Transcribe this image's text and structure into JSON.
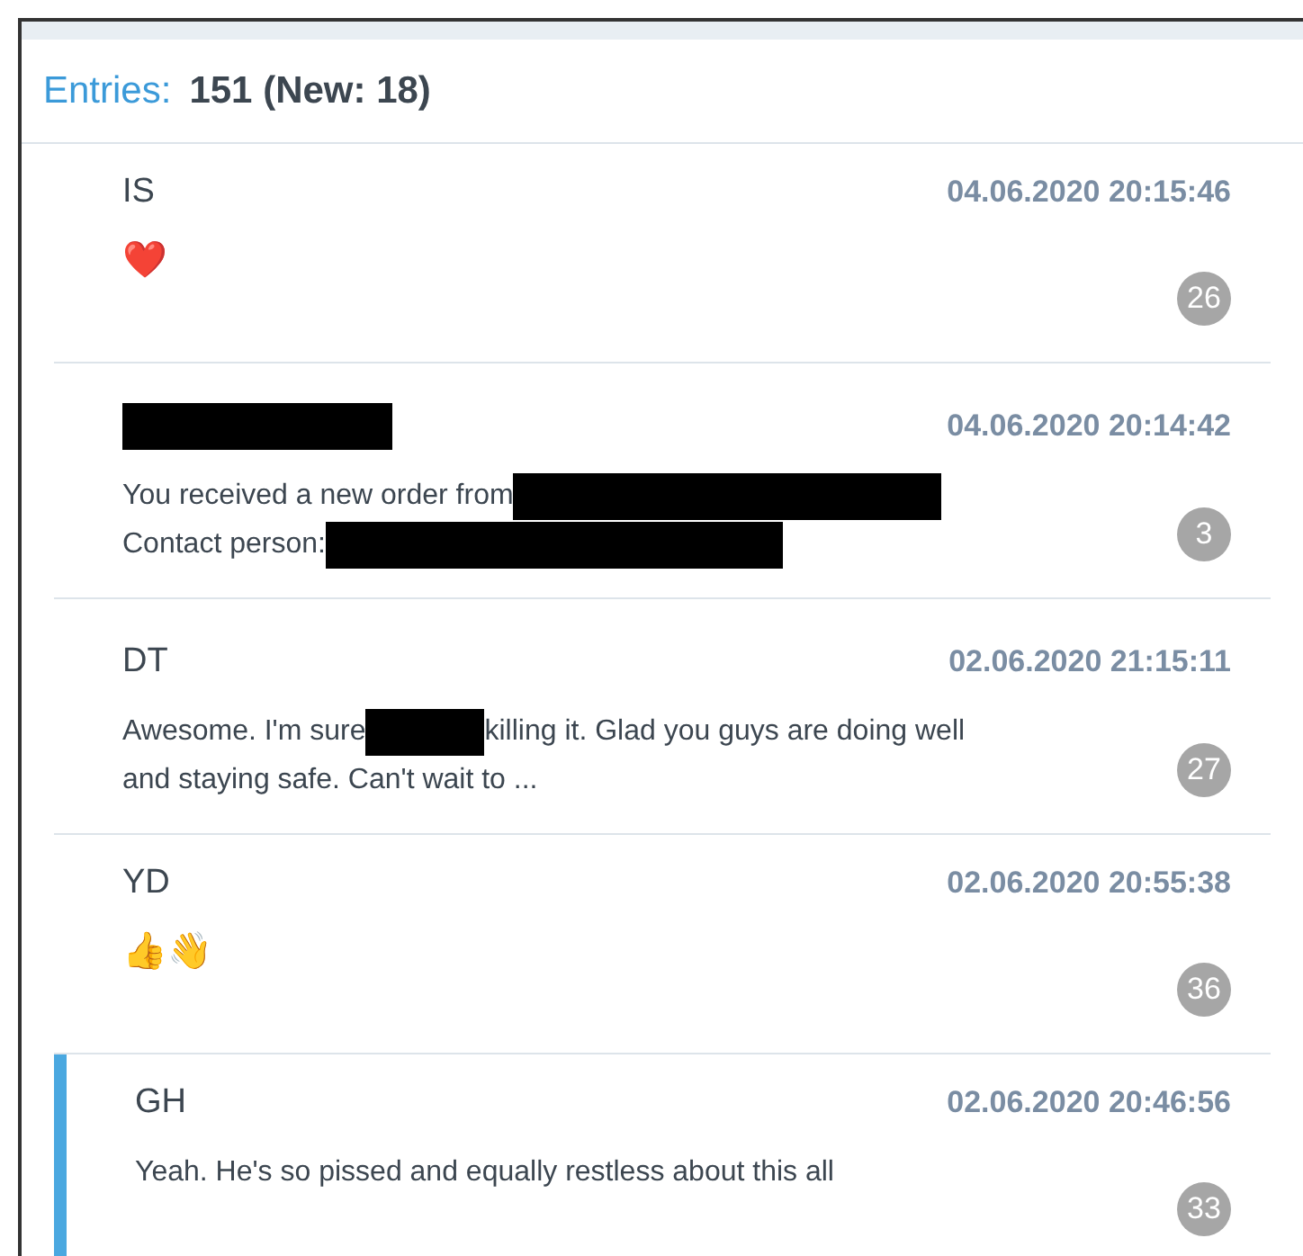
{
  "header": {
    "label": "Entries:",
    "count": "151 (New: 18)"
  },
  "entries": [
    {
      "selected": false,
      "sender": [
        {
          "kind": "text",
          "text": "IS"
        }
      ],
      "timestamp": "04.06.2020 20:15:46",
      "lines": [
        [
          {
            "kind": "emoji",
            "text": "❤️"
          }
        ]
      ],
      "badge": "26"
    },
    {
      "selected": false,
      "sender": [
        {
          "kind": "redacted"
        }
      ],
      "timestamp": "04.06.2020 20:14:42",
      "lines": [
        [
          {
            "kind": "text",
            "text": "You received a new order from"
          },
          {
            "kind": "redacted"
          }
        ],
        [
          {
            "kind": "text",
            "text": "Contact person:"
          },
          {
            "kind": "redacted"
          }
        ]
      ],
      "badge": "3"
    },
    {
      "selected": false,
      "sender": [
        {
          "kind": "text",
          "text": "DT"
        }
      ],
      "timestamp": "02.06.2020 21:15:11",
      "lines": [
        [
          {
            "kind": "text",
            "text": "Awesome. I'm sure"
          },
          {
            "kind": "redacted"
          },
          {
            "kind": "text",
            "text": "killing it. Glad you guys are doing well"
          }
        ],
        [
          {
            "kind": "text",
            "text": "and staying safe. Can't wait to ..."
          }
        ]
      ],
      "badge": "27"
    },
    {
      "selected": false,
      "sender": [
        {
          "kind": "text",
          "text": "YD"
        }
      ],
      "timestamp": "02.06.2020 20:55:38",
      "lines": [
        [
          {
            "kind": "emoji",
            "text": "👍👋"
          }
        ]
      ],
      "badge": "36"
    },
    {
      "selected": true,
      "sender": [
        {
          "kind": "text",
          "text": "GH"
        }
      ],
      "timestamp": "02.06.2020 20:46:56",
      "lines": [
        [
          {
            "kind": "text",
            "text": "Yeah. He's so pissed and equally restless about this all"
          }
        ]
      ],
      "badge": "33"
    }
  ]
}
